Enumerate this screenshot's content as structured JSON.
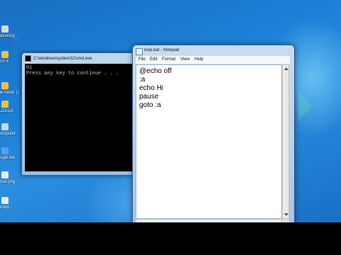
{
  "desktop_icons": [
    {
      "label": "desktop_...",
      "color": "#d8d8d8"
    },
    {
      "label": "GFX",
      "color": "#f0c040"
    },
    {
      "label": "w folder (3)",
      "color": "#f0c040"
    },
    {
      "label": "JZEDA",
      "color": "#f0c040"
    },
    {
      "label": "omputer",
      "color": "#c8d8e8"
    },
    {
      "label": "ogle.ble",
      "color": "#5aa0e0"
    },
    {
      "label": "ose.png",
      "color": "#e8e8e8"
    },
    {
      "label": "loopt...",
      "color": "#e8e8e8"
    }
  ],
  "cmd_window": {
    "title": "C:\\windows\\system32\\cmd.exe",
    "console_lines": [
      "Hi",
      "Press any key to continue . . ."
    ]
  },
  "notepad_window": {
    "title": "loop.bat - Notepad",
    "menu": [
      "File",
      "Edit",
      "Format",
      "View",
      "Help"
    ],
    "content_lines": [
      "@echo off",
      ":a",
      "echo Hi",
      "pause",
      "goto :a"
    ]
  }
}
